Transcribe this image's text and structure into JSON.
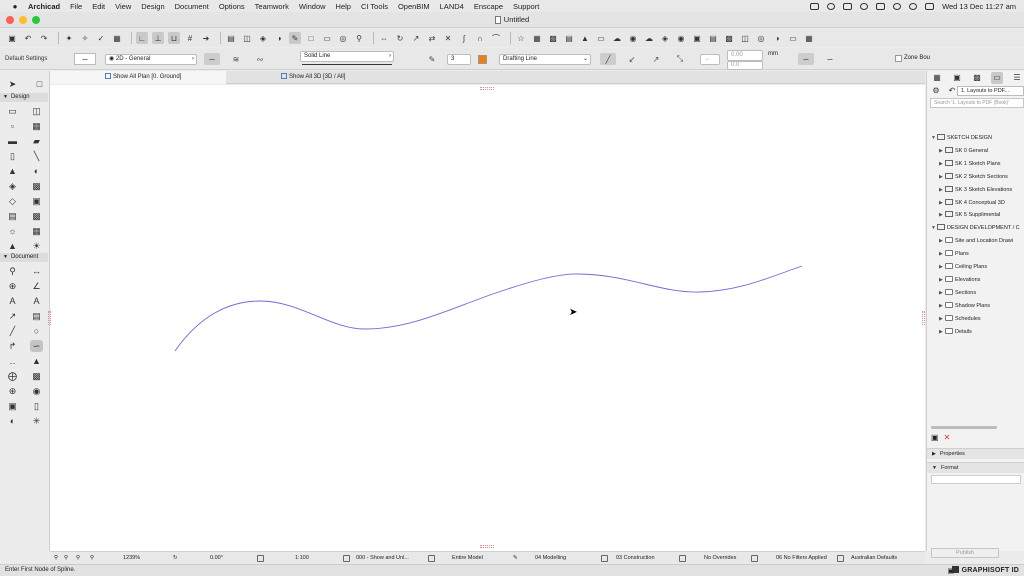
{
  "menubar": {
    "app_name": "Archicad",
    "items": [
      "File",
      "Edit",
      "View",
      "Design",
      "Document",
      "Options",
      "Teamwork",
      "Window",
      "Help",
      "CI Tools",
      "OpenBIM",
      "LAND4",
      "Enscape",
      "Support"
    ],
    "clock": "Wed 13 Dec  11:27 am"
  },
  "window": {
    "title": "Untitled"
  },
  "info_box": {
    "label": "Default Settings",
    "view_combo": "2D - General",
    "line_type": "Solid Line",
    "pen_number": "3",
    "layer": "Drafting Line",
    "dim_value_1": "0.00",
    "dim_value_2": "0.0",
    "unit": "mm",
    "zone_label": "Zone Bou"
  },
  "tabs": [
    {
      "label": "Show All Plan [0. Ground]"
    },
    {
      "label": "Show All 3D [3D / All]"
    }
  ],
  "toolbox": {
    "design_label": "Design",
    "document_label": "Document"
  },
  "navigator": {
    "combo": "1. Layouts to PDF...",
    "search_placeholder": "Search '1. Layouts to PDF (Book)'",
    "tree": [
      {
        "label": "SKETCH DESIGN",
        "level": 0,
        "kind": "book"
      },
      {
        "label": "SK 0 General",
        "level": 1,
        "kind": "sub"
      },
      {
        "label": "SK 1 Sketch Plans",
        "level": 1,
        "kind": "sub"
      },
      {
        "label": "SK 2 Sketch Sections",
        "level": 1,
        "kind": "sub"
      },
      {
        "label": "SK 3 Sketch Elevations",
        "level": 1,
        "kind": "sub"
      },
      {
        "label": "SK 4 Conceptual 3D",
        "level": 1,
        "kind": "sub"
      },
      {
        "label": "SK 5 Supplimental",
        "level": 1,
        "kind": "sub"
      },
      {
        "label": "DESIGN DEVELOPMENT / C",
        "level": 0,
        "kind": "book"
      },
      {
        "label": "Site and Location Drawi",
        "level": 1,
        "kind": "folder"
      },
      {
        "label": "Plans",
        "level": 1,
        "kind": "folder"
      },
      {
        "label": "Ceiling Plans",
        "level": 1,
        "kind": "folder"
      },
      {
        "label": "Elevations",
        "level": 1,
        "kind": "folder"
      },
      {
        "label": "Sections",
        "level": 1,
        "kind": "folder"
      },
      {
        "label": "Shadow Plans",
        "level": 1,
        "kind": "folder"
      },
      {
        "label": "Schedules",
        "level": 1,
        "kind": "folder"
      },
      {
        "label": "Details",
        "level": 1,
        "kind": "folder"
      }
    ],
    "properties_label": "Properties",
    "format_label": "Format",
    "publish_label": "Publish"
  },
  "statusbar": {
    "zoom": "1239%",
    "angle": "0.00°",
    "scale": "1:100",
    "layer_combo": "000 - Show and Unl...",
    "model_view": "Entire Model",
    "pen_set": "04 Modelling",
    "dimension": "03 Construction",
    "overrides": "No Overrides",
    "filters": "06 No Filters Applied",
    "defaults": "Australian Defaults"
  },
  "footer": {
    "hint": "Enter First Node of Spline.",
    "brand": "GRAPHISOFT ID"
  },
  "colors": {
    "spline": "#6b6bd6",
    "accent": "#ef7d12",
    "tab_icon": "#4b7fc4"
  }
}
